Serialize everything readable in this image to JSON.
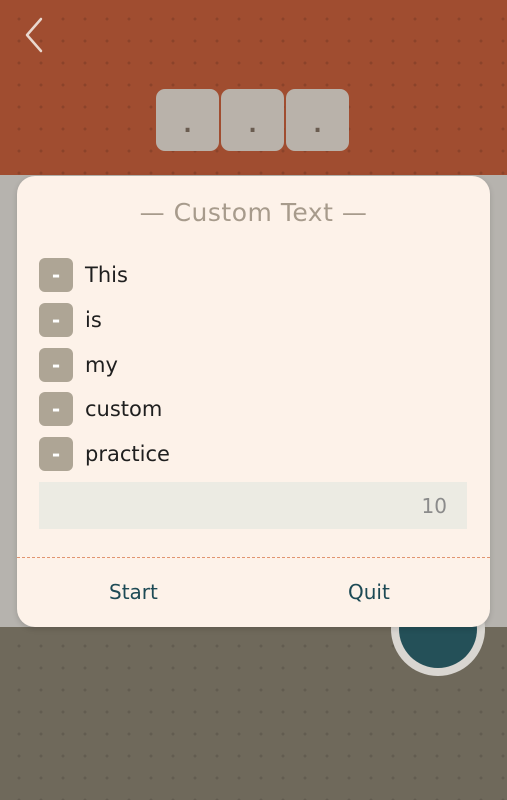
{
  "header": {
    "tiles": [
      ".",
      ".",
      "."
    ]
  },
  "dialog": {
    "title": "— Custom Text —",
    "items": [
      {
        "remove_label": "-",
        "word": "This"
      },
      {
        "remove_label": "-",
        "word": "is"
      },
      {
        "remove_label": "-",
        "word": "my"
      },
      {
        "remove_label": "-",
        "word": "custom"
      },
      {
        "remove_label": "-",
        "word": "practice"
      }
    ],
    "count_value": "10",
    "start_label": "Start",
    "quit_label": "Quit"
  },
  "icons": {
    "back": "chevron-left-icon",
    "fab": "refresh-icon"
  },
  "colors": {
    "header_bg": "#a04d30",
    "footer_bg": "#6f695b",
    "dialog_bg": "#fdf2e9",
    "accent_text": "#1d4a55",
    "divider": "#e19570"
  }
}
